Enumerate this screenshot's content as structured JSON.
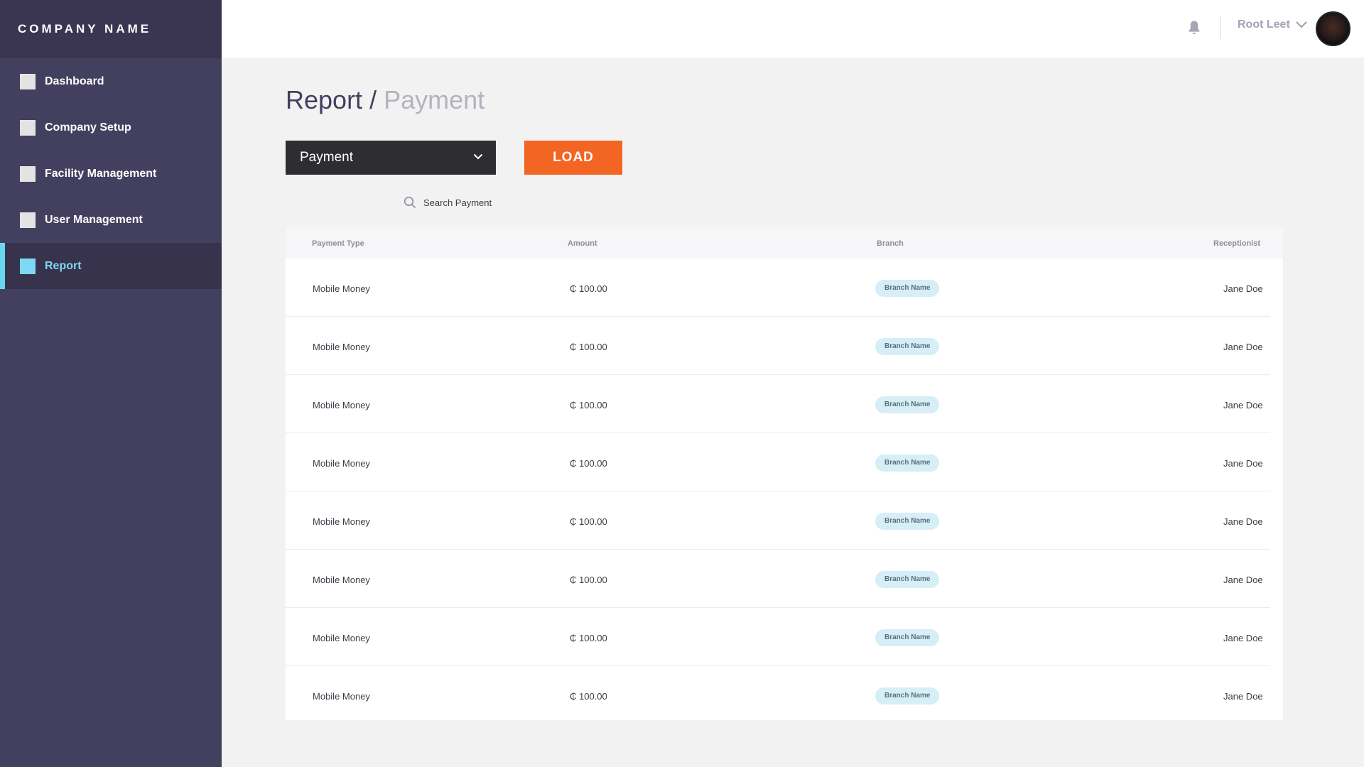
{
  "brand": "COMPANY NAME",
  "sidebar": {
    "items": [
      {
        "label": "Dashboard"
      },
      {
        "label": "Company Setup"
      },
      {
        "label": "Facility Management"
      },
      {
        "label": "User Management"
      },
      {
        "label": "Report"
      }
    ],
    "active_index": 4
  },
  "topbar": {
    "user_name": "Root Leet"
  },
  "page": {
    "title": "Report",
    "separator": "/",
    "subtitle": "Payment"
  },
  "filters": {
    "select_value": "Payment",
    "load_label": "LOAD"
  },
  "search": {
    "placeholder": "Search Payment"
  },
  "table": {
    "headers": [
      "Payment Type",
      "Amount",
      "Branch",
      "Receptionist"
    ],
    "rows": [
      [
        "Mobile Money",
        "₵ 100.00",
        "Branch Name",
        "Jane Doe"
      ],
      [
        "Mobile Money",
        "₵ 100.00",
        "Branch Name",
        "Jane Doe"
      ],
      [
        "Mobile Money",
        "₵ 100.00",
        "Branch Name",
        "Jane Doe"
      ],
      [
        "Mobile Money",
        "₵ 100.00",
        "Branch Name",
        "Jane Doe"
      ],
      [
        "Mobile Money",
        "₵ 100.00",
        "Branch Name",
        "Jane Doe"
      ],
      [
        "Mobile Money",
        "₵ 100.00",
        "Branch Name",
        "Jane Doe"
      ],
      [
        "Mobile Money",
        "₵ 100.00",
        "Branch Name",
        "Jane Doe"
      ],
      [
        "Mobile Money",
        "₵ 100.00",
        "Branch Name",
        "Jane Doe"
      ]
    ]
  },
  "colors": {
    "sidebar_bg": "#433f5e",
    "accent_active": "#7dd9f3",
    "load_button": "#f26522",
    "badge_bg": "#d6eef6"
  },
  "icons": [
    "bell-icon",
    "chevron-down-icon",
    "search-icon",
    "avatar"
  ]
}
